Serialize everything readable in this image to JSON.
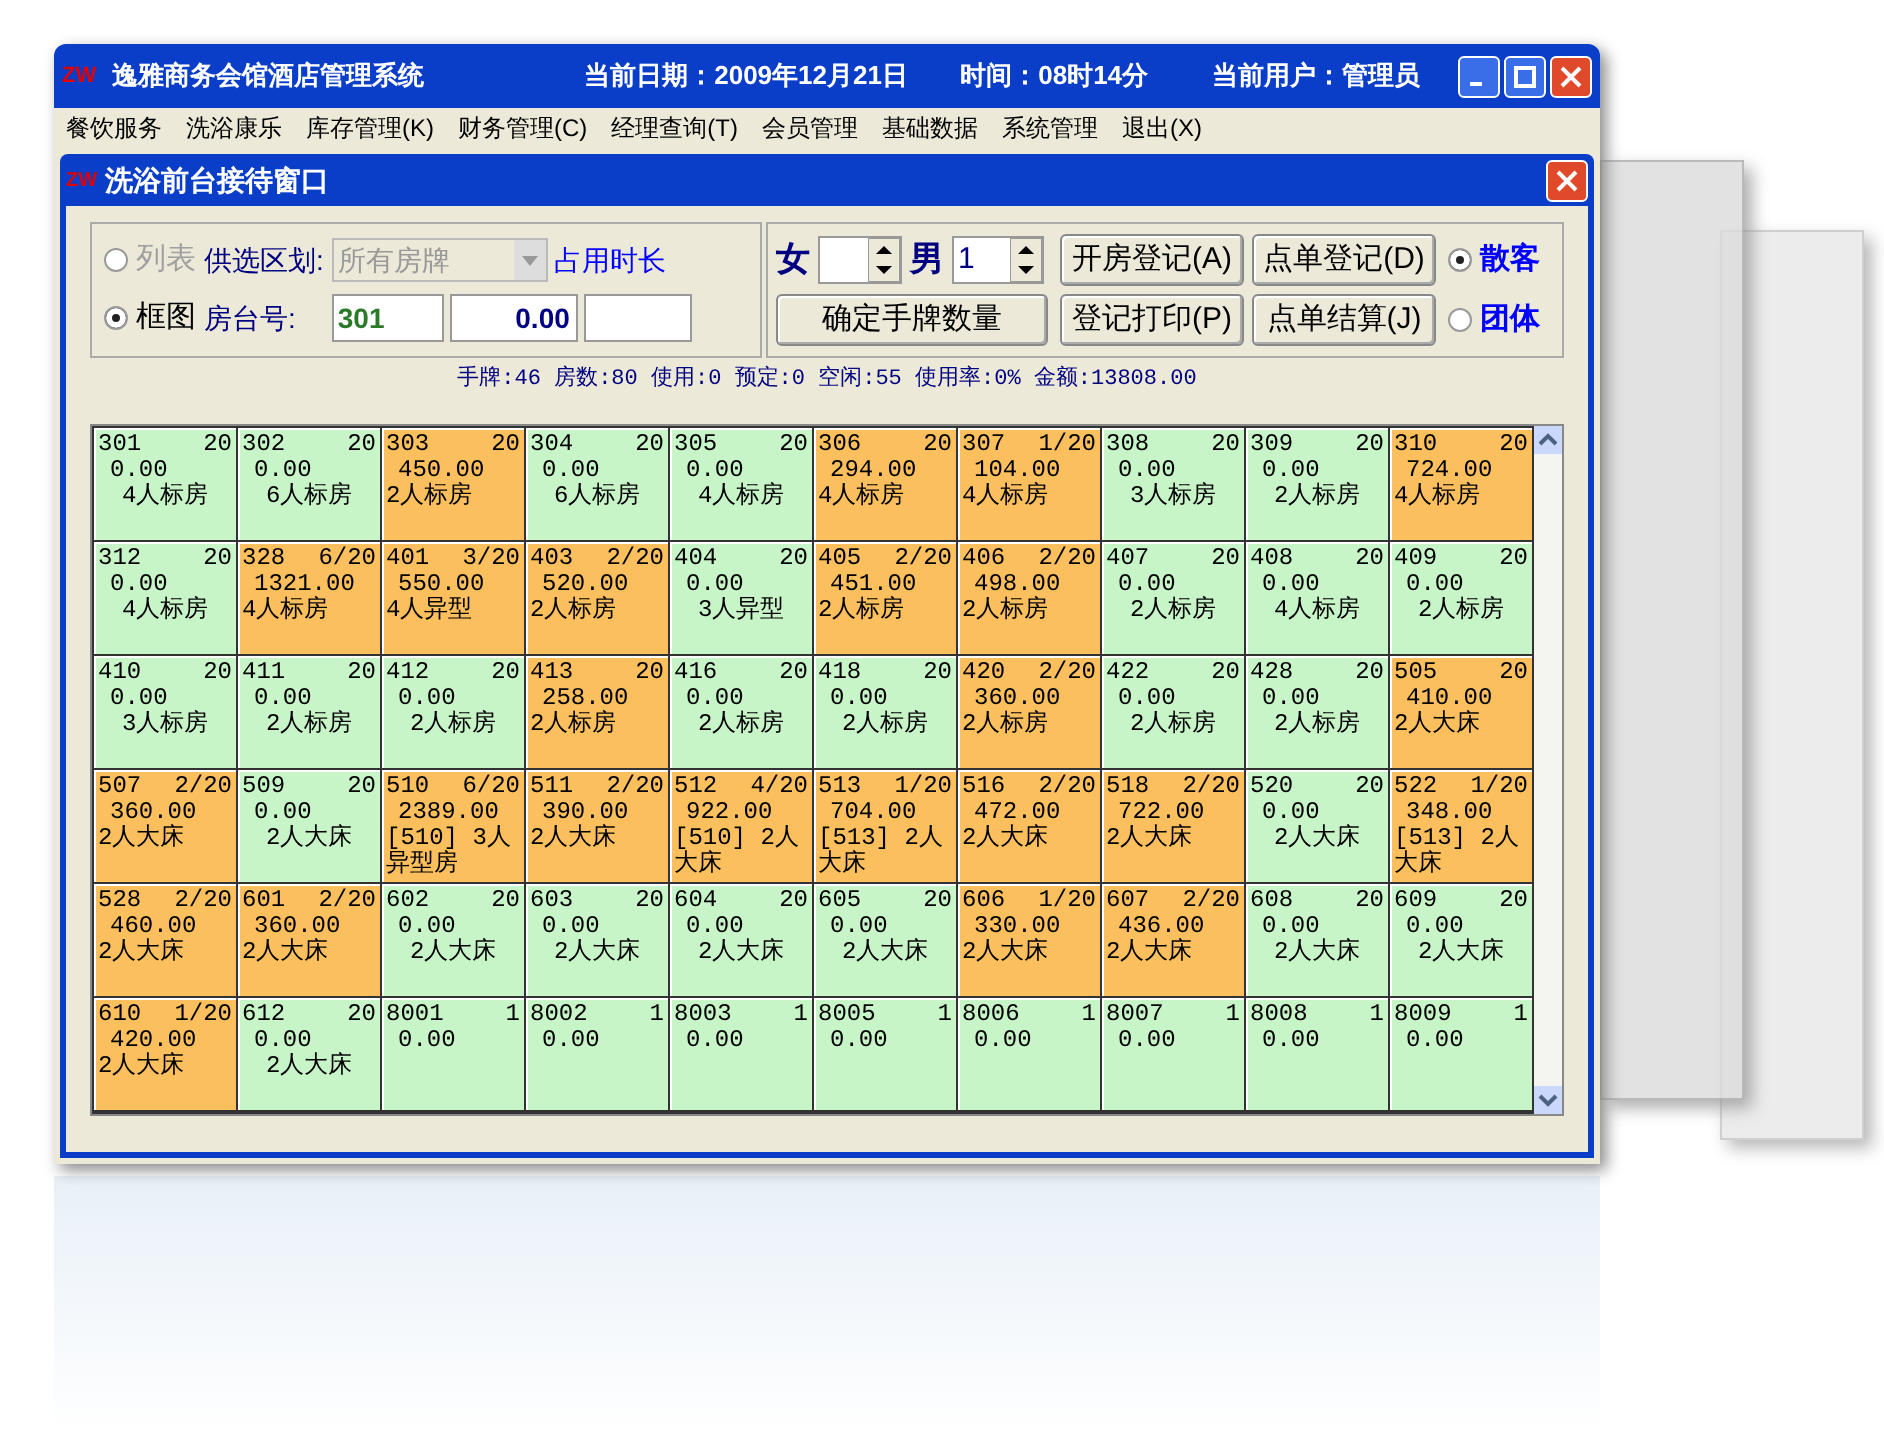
{
  "window": {
    "logo": "ZW",
    "title": "逸雅商务会馆酒店管理系统",
    "date": "当前日期：2009年12月21日",
    "time": "时间：08时14分",
    "user": "当前用户：管理员"
  },
  "menu": [
    "餐饮服务",
    "洗浴康乐",
    "库存管理(K)",
    "财务管理(C)",
    "经理查询(T)",
    "会员管理",
    "基础数据",
    "系统管理",
    "退出(X)"
  ],
  "child_window": {
    "logo": "ZW",
    "title": "洗浴前台接待窗口"
  },
  "view_options": [
    {
      "label": "列表",
      "selected": false,
      "disabled": true
    },
    {
      "label": "框图",
      "selected": true,
      "disabled": false
    }
  ],
  "area_label": "供选区划:",
  "area_select": {
    "value": "所有房牌",
    "disabled": true
  },
  "duration_label": "占用时长",
  "room_label": "房台号:",
  "room_fields": [
    "301",
    "0.00"
  ],
  "female_label": "女",
  "male_label": "男",
  "male_value": "1",
  "buttons": [
    "开房登记(A)",
    "点单登记(D)",
    "确定手牌数量",
    "登记打印(P)",
    "点单结算(J)"
  ],
  "guest_types": [
    {
      "label": "散客",
      "selected": true
    },
    {
      "label": "团体",
      "selected": false
    }
  ],
  "status_line": "手牌:46 房数:80 使用:0 预定:0 空闲:55 使用率:0% 金额:13808.00",
  "rooms": [
    {
      "number": "301",
      "count": "20",
      "amount": "0.00",
      "type": "4人标房",
      "occupied": false
    },
    {
      "number": "302",
      "count": "20",
      "amount": "0.00",
      "type": "6人标房",
      "occupied": false
    },
    {
      "number": "303",
      "count": "20",
      "amount": "450.00",
      "type": "2人标房",
      "occupied": true
    },
    {
      "number": "304",
      "count": "20",
      "amount": "0.00",
      "type": "6人标房",
      "occupied": false
    },
    {
      "number": "305",
      "count": "20",
      "amount": "0.00",
      "type": "4人标房",
      "occupied": false
    },
    {
      "number": "306",
      "count": "20",
      "amount": "294.00",
      "type": "4人标房",
      "occupied": true
    },
    {
      "number": "307",
      "count": "1/20",
      "amount": "104.00",
      "type": "4人标房",
      "occupied": true
    },
    {
      "number": "308",
      "count": "20",
      "amount": "0.00",
      "type": "3人标房",
      "occupied": false
    },
    {
      "number": "309",
      "count": "20",
      "amount": "0.00",
      "type": "2人标房",
      "occupied": false
    },
    {
      "number": "310",
      "count": "20",
      "amount": "724.00",
      "type": "4人标房",
      "occupied": true
    },
    {
      "number": "312",
      "count": "20",
      "amount": "0.00",
      "type": "4人标房",
      "occupied": false
    },
    {
      "number": "328",
      "count": "6/20",
      "amount": "1321.00",
      "type": "4人标房",
      "occupied": true
    },
    {
      "number": "401",
      "count": "3/20",
      "amount": "550.00",
      "type": "4人异型",
      "occupied": true
    },
    {
      "number": "403",
      "count": "2/20",
      "amount": "520.00",
      "type": "2人标房",
      "occupied": true
    },
    {
      "number": "404",
      "count": "20",
      "amount": "0.00",
      "type": "3人异型",
      "occupied": false
    },
    {
      "number": "405",
      "count": "2/20",
      "amount": "451.00",
      "type": "2人标房",
      "occupied": true
    },
    {
      "number": "406",
      "count": "2/20",
      "amount": "498.00",
      "type": "2人标房",
      "occupied": true
    },
    {
      "number": "407",
      "count": "20",
      "amount": "0.00",
      "type": "2人标房",
      "occupied": false
    },
    {
      "number": "408",
      "count": "20",
      "amount": "0.00",
      "type": "4人标房",
      "occupied": false
    },
    {
      "number": "409",
      "count": "20",
      "amount": "0.00",
      "type": "2人标房",
      "occupied": false
    },
    {
      "number": "410",
      "count": "20",
      "amount": "0.00",
      "type": "3人标房",
      "occupied": false
    },
    {
      "number": "411",
      "count": "20",
      "amount": "0.00",
      "type": "2人标房",
      "occupied": false
    },
    {
      "number": "412",
      "count": "20",
      "amount": "0.00",
      "type": "2人标房",
      "occupied": false
    },
    {
      "number": "413",
      "count": "20",
      "amount": "258.00",
      "type": "2人标房",
      "occupied": true
    },
    {
      "number": "416",
      "count": "20",
      "amount": "0.00",
      "type": "2人标房",
      "occupied": false
    },
    {
      "number": "418",
      "count": "20",
      "amount": "0.00",
      "type": "2人标房",
      "occupied": false
    },
    {
      "number": "420",
      "count": "2/20",
      "amount": "360.00",
      "type": "2人标房",
      "occupied": true
    },
    {
      "number": "422",
      "count": "20",
      "amount": "0.00",
      "type": "2人标房",
      "occupied": false
    },
    {
      "number": "428",
      "count": "20",
      "amount": "0.00",
      "type": "2人标房",
      "occupied": false
    },
    {
      "number": "505",
      "count": "20",
      "amount": "410.00",
      "type": "2人大床",
      "occupied": true
    },
    {
      "number": "507",
      "count": "2/20",
      "amount": "360.00",
      "type": "2人大床",
      "occupied": true
    },
    {
      "number": "509",
      "count": "20",
      "amount": "0.00",
      "type": "2人大床",
      "occupied": false
    },
    {
      "number": "510",
      "count": "6/20",
      "amount": "2389.00",
      "type": "[510] 3人异型房",
      "occupied": true
    },
    {
      "number": "511",
      "count": "2/20",
      "amount": "390.00",
      "type": "2人大床",
      "occupied": true
    },
    {
      "number": "512",
      "count": "4/20",
      "amount": "922.00",
      "type": "[510] 2人大床",
      "occupied": true
    },
    {
      "number": "513",
      "count": "1/20",
      "amount": "704.00",
      "type": "[513] 2人大床",
      "occupied": true
    },
    {
      "number": "516",
      "count": "2/20",
      "amount": "472.00",
      "type": "2人大床",
      "occupied": true
    },
    {
      "number": "518",
      "count": "2/20",
      "amount": "722.00",
      "type": "2人大床",
      "occupied": true
    },
    {
      "number": "520",
      "count": "20",
      "amount": "0.00",
      "type": "2人大床",
      "occupied": false
    },
    {
      "number": "522",
      "count": "1/20",
      "amount": "348.00",
      "type": "[513] 2人大床",
      "occupied": true
    },
    {
      "number": "528",
      "count": "2/20",
      "amount": "460.00",
      "type": "2人大床",
      "occupied": true
    },
    {
      "number": "601",
      "count": "2/20",
      "amount": "360.00",
      "type": "2人大床",
      "occupied": true
    },
    {
      "number": "602",
      "count": "20",
      "amount": "0.00",
      "type": "2人大床",
      "occupied": false
    },
    {
      "number": "603",
      "count": "20",
      "amount": "0.00",
      "type": "2人大床",
      "occupied": false
    },
    {
      "number": "604",
      "count": "20",
      "amount": "0.00",
      "type": "2人大床",
      "occupied": false
    },
    {
      "number": "605",
      "count": "20",
      "amount": "0.00",
      "type": "2人大床",
      "occupied": false
    },
    {
      "number": "606",
      "count": "1/20",
      "amount": "330.00",
      "type": "2人大床",
      "occupied": true
    },
    {
      "number": "607",
      "count": "2/20",
      "amount": "436.00",
      "type": "2人大床",
      "occupied": true
    },
    {
      "number": "608",
      "count": "20",
      "amount": "0.00",
      "type": "2人大床",
      "occupied": false
    },
    {
      "number": "609",
      "count": "20",
      "amount": "0.00",
      "type": "2人大床",
      "occupied": false
    },
    {
      "number": "610",
      "count": "1/20",
      "amount": "420.00",
      "type": "2人大床",
      "occupied": true
    },
    {
      "number": "612",
      "count": "20",
      "amount": "0.00",
      "type": "2人大床",
      "occupied": false
    },
    {
      "number": "8001",
      "count": "1",
      "amount": "0.00",
      "occupied": false
    },
    {
      "number": "8002",
      "count": "1",
      "amount": "0.00",
      "occupied": false
    },
    {
      "number": "8003",
      "count": "1",
      "amount": "0.00",
      "occupied": false
    },
    {
      "number": "8005",
      "count": "1",
      "amount": "0.00",
      "occupied": false
    },
    {
      "number": "8006",
      "count": "1",
      "amount": "0.00",
      "occupied": false
    },
    {
      "number": "8007",
      "count": "1",
      "amount": "0.00",
      "occupied": false
    },
    {
      "number": "8008",
      "count": "1",
      "amount": "0.00",
      "occupied": false
    },
    {
      "number": "8009",
      "count": "1",
      "amount": "0.00",
      "occupied": false
    }
  ]
}
